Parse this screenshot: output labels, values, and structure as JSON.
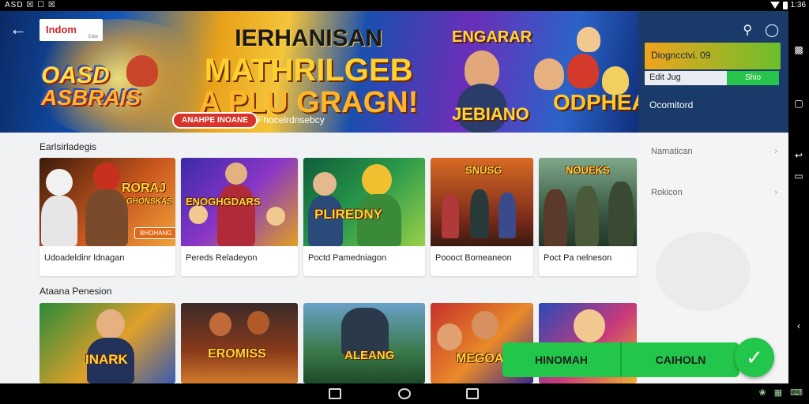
{
  "status_bar": {
    "left": "ASD ☒ ☐ ☒",
    "right": "1:36"
  },
  "banner": {
    "brand": "Indom",
    "brand_sub": "Edie",
    "game_logo_line1": "OASD",
    "game_logo_line2": "ASBRAIS",
    "title_line1": "IERHANISAN",
    "title_line2": "MATHRILGEB",
    "title_line3": "A PLU GRAGN!",
    "cta_label": "ANAHPE INOANE",
    "cta_sub": "Fhocelrdnsebcy",
    "sticker_top": "ENGARAR",
    "sticker_mid": "JEBIANO",
    "sticker_right": "ODPHEAD"
  },
  "panel": {
    "green_text": "Diogncctvi. 09",
    "row2_label": "Edit Jug",
    "row2_button": "Shio",
    "text": "Ocomitord",
    "items": [
      {
        "label": "Namatican",
        "arrow": "›"
      },
      {
        "label": "Rokicon",
        "arrow": "›"
      }
    ]
  },
  "sections": {
    "first_title": "Earlsirladegis",
    "second_title": "Ataana Penesion",
    "row1_cards": [
      {
        "art_title": "RORAJ",
        "art_sub": "GHONSKAS",
        "art_button": "BHOHANG",
        "caption": "Udoadeldinr ldnagan"
      },
      {
        "art_title": "ENOGHGDARS",
        "caption": "Pereds Reladeyon"
      },
      {
        "art_title": "PLIREDNY",
        "caption": "Poctd Pamedniagon"
      },
      {
        "art_title": "SNUSG",
        "caption": "Poooct Bomeaneon"
      },
      {
        "art_title": "NOUEKS",
        "caption": "Poct Pa nelneson"
      }
    ],
    "row2_cards": [
      {
        "art_title": "INARK"
      },
      {
        "art_title": "EROMISS"
      },
      {
        "art_title": "ALEANG"
      },
      {
        "art_title": "MEGOAS"
      },
      {
        "art_title": ""
      }
    ]
  },
  "actions": {
    "left_label": "HINOMAH",
    "right_label": "CAIHOLN",
    "fab_icon": "check-icon"
  },
  "colors": {
    "accent_green": "#22c64a",
    "panel_blue": "#1a3a6a",
    "cta_red": "#d8342c"
  }
}
